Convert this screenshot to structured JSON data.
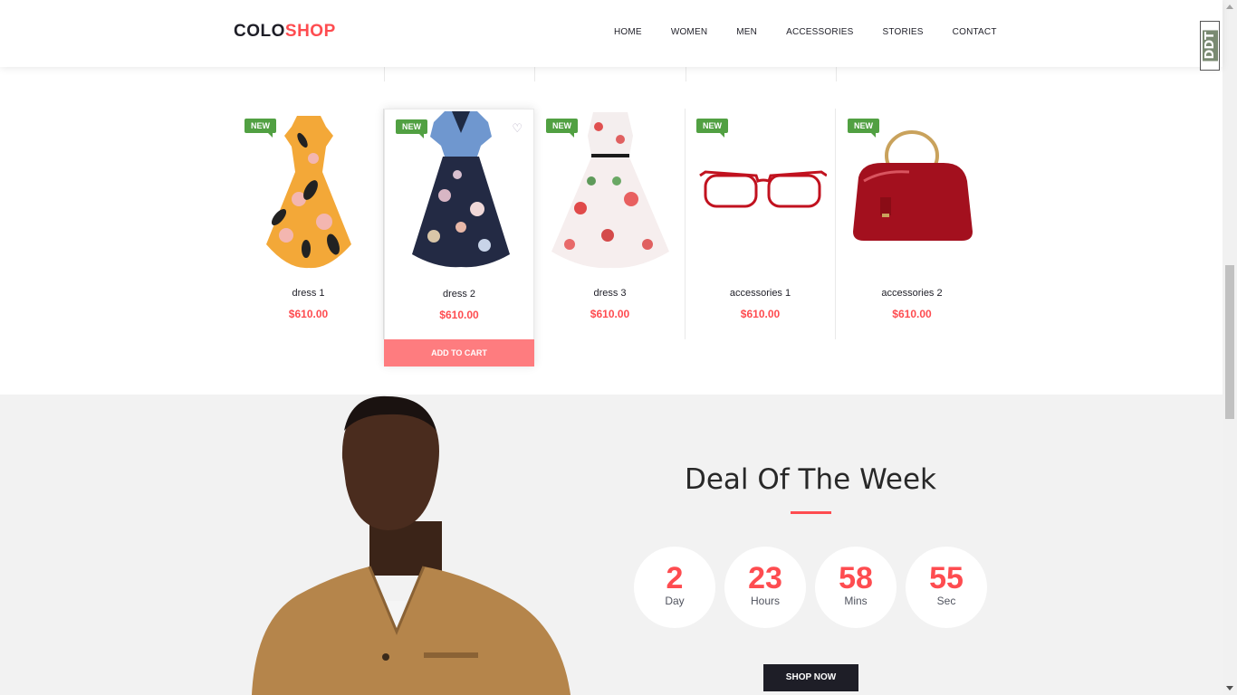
{
  "header": {
    "logo_part1": "COLO",
    "logo_part2": "SHOP",
    "nav": [
      "HOME",
      "WOMEN",
      "MEN",
      "ACCESSORIES",
      "STORIES",
      "CONTACT"
    ],
    "side_badge": "DDT"
  },
  "products": [
    {
      "badge": "NEW",
      "name": "dress 1",
      "price": "$610.00"
    },
    {
      "badge": "NEW",
      "name": "dress 2",
      "price": "$610.00",
      "add_to_cart": "ADD TO CART"
    },
    {
      "badge": "NEW",
      "name": "dress 3",
      "price": "$610.00"
    },
    {
      "badge": "NEW",
      "name": "accessories 1",
      "price": "$610.00"
    },
    {
      "badge": "NEW",
      "name": "accessories 2",
      "price": "$610.00"
    }
  ],
  "deal": {
    "title": "Deal Of The Week",
    "timer": [
      {
        "value": "2",
        "label": "Day"
      },
      {
        "value": "23",
        "label": "Hours"
      },
      {
        "value": "58",
        "label": "Mins"
      },
      {
        "value": "55",
        "label": "Sec"
      }
    ],
    "button": "SHOP NOW"
  },
  "colors": {
    "accent": "#fe4c50",
    "badge_green": "#51a042",
    "dark": "#1e1e27",
    "deal_bg": "#f2f2f2"
  }
}
